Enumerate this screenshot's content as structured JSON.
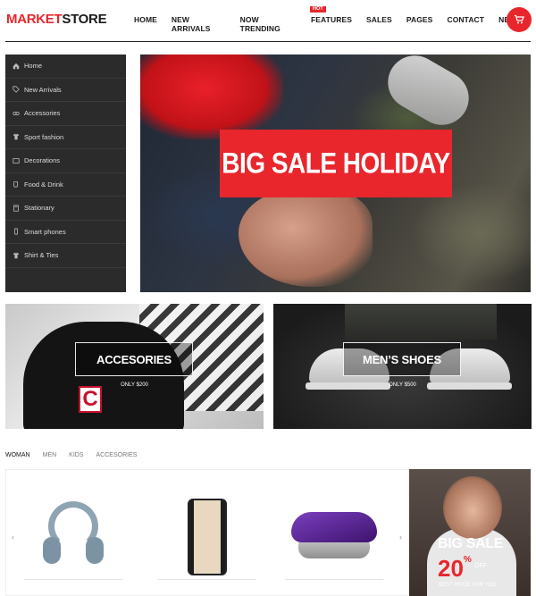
{
  "brand": {
    "part1": "MARKET",
    "part2": "STORE"
  },
  "nav": {
    "items": [
      {
        "label": "HOME"
      },
      {
        "label": "NEW ARRIVALS"
      },
      {
        "label": "NOW TRENDING"
      },
      {
        "label": "FEATURES"
      },
      {
        "label": "SALES"
      },
      {
        "label": "PAGES"
      },
      {
        "label": "CONTACT"
      },
      {
        "label": "NEWS"
      }
    ],
    "hot_badge": "HOT"
  },
  "sidebar": {
    "items": [
      {
        "label": "Home",
        "icon": "home-icon"
      },
      {
        "label": "New Arrivals",
        "icon": "tag-icon"
      },
      {
        "label": "Accessories",
        "icon": "glasses-icon"
      },
      {
        "label": "Sport fashion",
        "icon": "shirt-icon"
      },
      {
        "label": "Decorations",
        "icon": "frame-icon"
      },
      {
        "label": "Food & Drink",
        "icon": "cup-icon"
      },
      {
        "label": "Stationary",
        "icon": "book-icon"
      },
      {
        "label": "Smart phones",
        "icon": "phone-icon"
      },
      {
        "label": "Shirt & Ties",
        "icon": "shirt-icon"
      }
    ]
  },
  "hero": {
    "title": "BIG SALE HOLIDAY"
  },
  "banners": [
    {
      "title": "ACCESORIES",
      "subtitle": "ONLY $200"
    },
    {
      "title": "MEN’S SHOES",
      "subtitle": "ONLY $500"
    }
  ],
  "product_tabs": [
    "WOMAN",
    "MEN",
    "KIDS",
    "ACCESORIES"
  ],
  "arrows": {
    "prev": "‹",
    "next": "›"
  },
  "promo": {
    "title": "BIG SALE",
    "percent": "20",
    "percent_sign": "%",
    "off": "OFF",
    "subtitle": "BEST PRICE FOR YOU"
  },
  "colors": {
    "accent": "#e8262c",
    "sidebar_bg": "#2b2b2b"
  }
}
